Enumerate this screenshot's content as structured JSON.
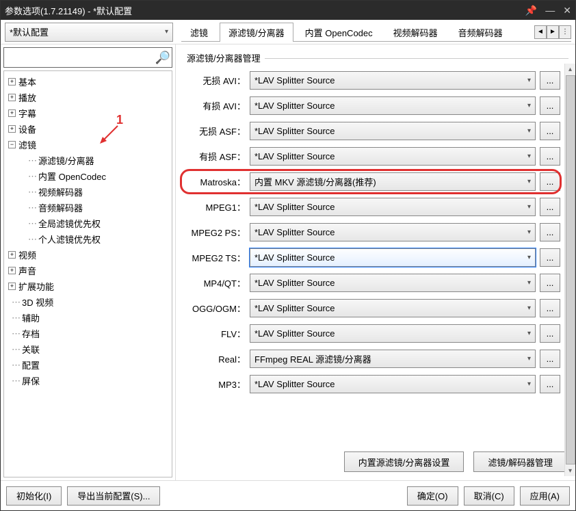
{
  "window": {
    "title": "参数选项(1.7.21149) - *默认配置"
  },
  "titlebar_icons": {
    "pin": "📌",
    "line": "—",
    "close": "✕"
  },
  "config": {
    "current": "*默认配置"
  },
  "tabs": {
    "items": [
      "滤镜",
      "源滤镜/分离器",
      "内置 OpenCodec",
      "视频解码器",
      "音频解码器"
    ],
    "active_index": 1
  },
  "search": {
    "placeholder": ""
  },
  "tree": {
    "items": [
      {
        "label": "基本",
        "kind": "branch",
        "state": "+",
        "depth": 0
      },
      {
        "label": "播放",
        "kind": "branch",
        "state": "+",
        "depth": 0
      },
      {
        "label": "字幕",
        "kind": "branch",
        "state": "+",
        "depth": 0
      },
      {
        "label": "设备",
        "kind": "branch",
        "state": "+",
        "depth": 0
      },
      {
        "label": "滤镜",
        "kind": "branch",
        "state": "-",
        "depth": 0
      },
      {
        "label": "源滤镜/分离器",
        "kind": "leaf",
        "depth": 1
      },
      {
        "label": "内置 OpenCodec",
        "kind": "leaf",
        "depth": 1
      },
      {
        "label": "视频解码器",
        "kind": "leaf",
        "depth": 1
      },
      {
        "label": "音频解码器",
        "kind": "leaf",
        "depth": 1
      },
      {
        "label": "全局滤镜优先权",
        "kind": "leaf",
        "depth": 1
      },
      {
        "label": "个人滤镜优先权",
        "kind": "leaf",
        "depth": 1
      },
      {
        "label": "视频",
        "kind": "branch",
        "state": "+",
        "depth": 0
      },
      {
        "label": "声音",
        "kind": "branch",
        "state": "+",
        "depth": 0
      },
      {
        "label": "扩展功能",
        "kind": "branch",
        "state": "+",
        "depth": 0
      },
      {
        "label": "3D 视频",
        "kind": "leaf",
        "depth": 0
      },
      {
        "label": "辅助",
        "kind": "leaf",
        "depth": 0
      },
      {
        "label": "存档",
        "kind": "leaf",
        "depth": 0
      },
      {
        "label": "关联",
        "kind": "leaf",
        "depth": 0
      },
      {
        "label": "配置",
        "kind": "leaf",
        "depth": 0
      },
      {
        "label": "屏保",
        "kind": "leaf",
        "depth": 0
      }
    ]
  },
  "panel": {
    "title": "源滤镜/分离器管理",
    "rows": [
      {
        "label": "无损 AVI：",
        "value": "*LAV Splitter Source",
        "highlight": false
      },
      {
        "label": "有损 AVI：",
        "value": "*LAV Splitter Source",
        "highlight": false
      },
      {
        "label": "无损 ASF：",
        "value": "*LAV Splitter Source",
        "highlight": false
      },
      {
        "label": "有损 ASF：",
        "value": "*LAV Splitter Source",
        "highlight": false
      },
      {
        "label": "Matroska：",
        "value": "内置 MKV 源滤镜/分离器(推荐)",
        "highlight": true
      },
      {
        "label": "MPEG1：",
        "value": "*LAV Splitter Source",
        "highlight": false
      },
      {
        "label": "MPEG2 PS：",
        "value": "*LAV Splitter Source",
        "highlight": false
      },
      {
        "label": "MPEG2 TS：",
        "value": "*LAV Splitter Source",
        "highlight": false,
        "selected": true
      },
      {
        "label": "MP4/QT：",
        "value": "*LAV Splitter Source",
        "highlight": false
      },
      {
        "label": "OGG/OGM：",
        "value": "*LAV Splitter Source",
        "highlight": false
      },
      {
        "label": "FLV：",
        "value": "*LAV Splitter Source",
        "highlight": false
      },
      {
        "label": "Real：",
        "value": "FFmpeg REAL 源滤镜/分离器",
        "highlight": false
      },
      {
        "label": "MP3：",
        "value": "*LAV Splitter Source",
        "highlight": false
      }
    ],
    "sub_buttons": [
      "内置源滤镜/分离器设置",
      "滤镜/解码器管理"
    ],
    "more_label": "..."
  },
  "annotation": {
    "number": "1"
  },
  "bottom": {
    "init": "初始化(I)",
    "export": "导出当前配置(S)...",
    "ok": "确定(O)",
    "cancel": "取消(C)",
    "apply": "应用(A)"
  }
}
